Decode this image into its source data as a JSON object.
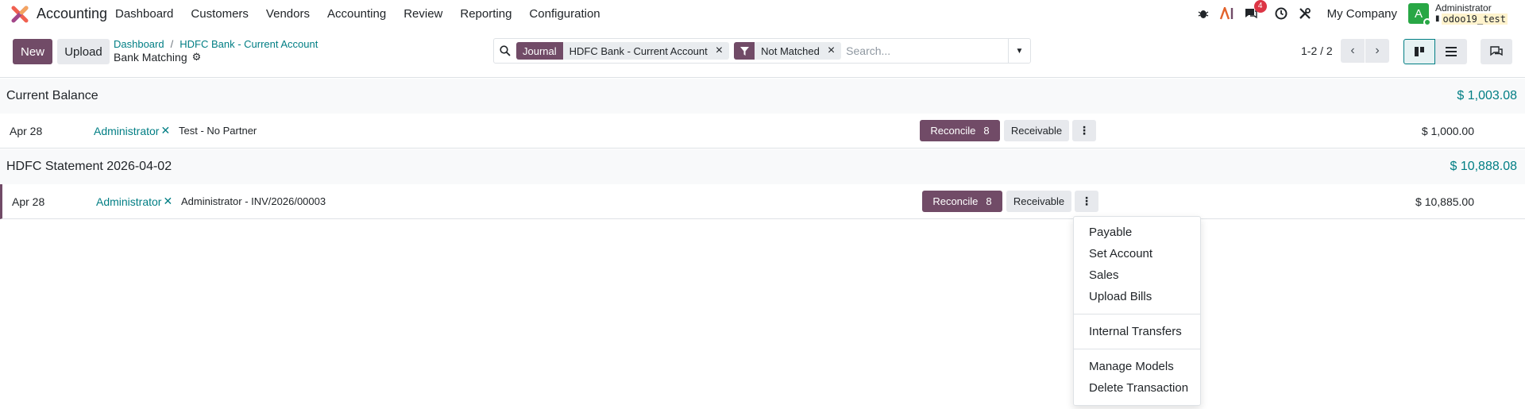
{
  "navbar": {
    "app_name": "Accounting",
    "menu": [
      "Dashboard",
      "Customers",
      "Vendors",
      "Accounting",
      "Review",
      "Reporting",
      "Configuration"
    ],
    "chat_badge": "4",
    "company": "My Company",
    "avatar_letter": "A",
    "user_name": "Administrator",
    "db_name": "odoo19_test"
  },
  "control": {
    "new_label": "New",
    "upload_label": "Upload",
    "breadcrumb": [
      "Dashboard",
      "HDFC Bank - Current Account"
    ],
    "breadcrumb_sep": "/",
    "page_title": "Bank Matching",
    "search": {
      "facets": [
        {
          "label": "Journal",
          "value": "HDFC Bank - Current Account"
        },
        {
          "label": "",
          "value": "Not Matched"
        }
      ],
      "placeholder": "Search..."
    },
    "pager": "1-2 / 2"
  },
  "groups": [
    {
      "title": "Current Balance",
      "amount": "$ 1,003.08",
      "row": {
        "date": "Apr 28",
        "partner": "Administrator",
        "label": "Test - No Partner",
        "reconcile_label": "Reconcile",
        "reconcile_count": "8",
        "receivable_label": "Receivable",
        "amount": "$ 1,000.00"
      }
    },
    {
      "title": "HDFC Statement 2026-04-02",
      "amount": "$ 10,888.08",
      "row": {
        "date": "Apr 28",
        "partner": "Administrator",
        "label": "Administrator - INV/2026/00003",
        "reconcile_label": "Reconcile",
        "reconcile_count": "8",
        "receivable_label": "Receivable",
        "amount": "$ 10,885.00"
      }
    }
  ],
  "dropdown": {
    "section1": [
      "Payable",
      "Set Account",
      "Sales",
      "Upload Bills"
    ],
    "section2": [
      "Internal Transfers"
    ],
    "section3": [
      "Manage Models",
      "Delete Transaction"
    ]
  },
  "colors": {
    "brand": "#714b67",
    "link": "#017e84"
  }
}
